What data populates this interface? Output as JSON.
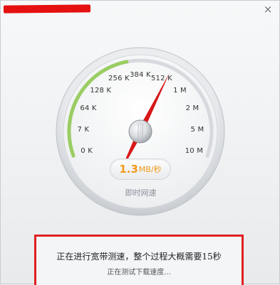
{
  "window": {
    "close_glyph": "×"
  },
  "gauge": {
    "ticks": [
      "0 K",
      "7 K",
      "64 K",
      "128 K",
      "256 K",
      "384 K",
      "512 K",
      "1 M",
      "2 M",
      "5 M",
      "10 M"
    ],
    "needle_fraction": 0.62,
    "progress_arc_fraction": 0.45,
    "speed_value": "1.3",
    "speed_unit": "MB/秒",
    "label": "即时网速",
    "colors": {
      "needle": "#d81818",
      "progress_arc": "#9acd62",
      "readout": "#f19a1a"
    }
  },
  "status": {
    "main": "正在进行宽带测速，整个过程大概需要15秒",
    "sub": "正在测试下载速度..."
  }
}
